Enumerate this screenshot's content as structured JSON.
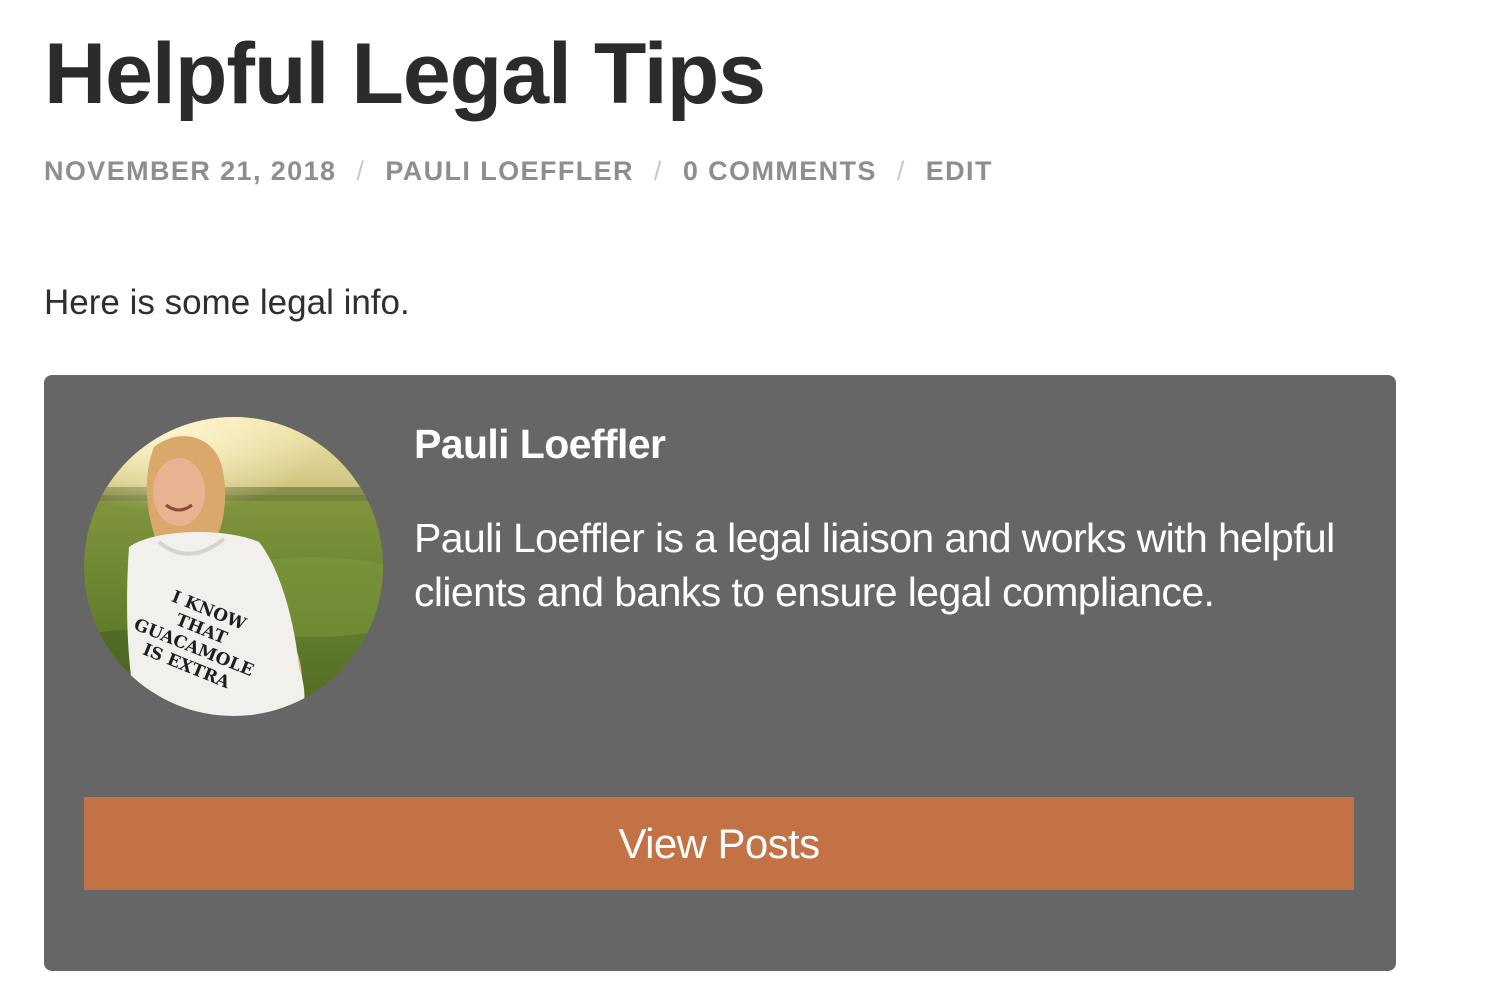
{
  "post": {
    "title": "Helpful Legal Tips",
    "meta": {
      "date": "NOVEMBER 21, 2018",
      "author": "PAULI LOEFFLER",
      "comments": "0 COMMENTS",
      "edit": "EDIT",
      "separator": "/"
    },
    "body": "Here is some legal info."
  },
  "author_box": {
    "name": "Pauli Loeffler",
    "bio": "Pauli Loeffler is a legal liaison and works with helpful clients and banks to ensure legal compliance.",
    "view_posts_label": "View Posts",
    "avatar": {
      "shirt_text": [
        "I KNOW",
        "THAT",
        "GUACAMOLE",
        "IS EXTRA"
      ]
    },
    "colors": {
      "box_background": "#666666",
      "button_background": "#c27244",
      "text": "#ffffff"
    }
  }
}
